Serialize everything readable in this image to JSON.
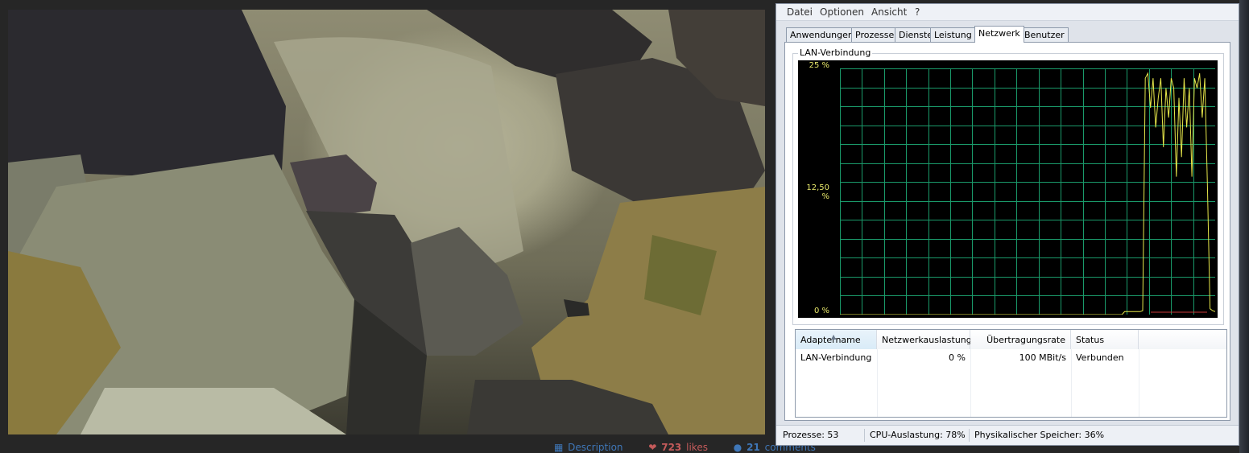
{
  "photo": {
    "alt_icons": [
      "grid-icon",
      "heart-icon",
      "comment-icon"
    ],
    "footer": {
      "description_label": "Description",
      "likes_count": "723",
      "likes_label": "likes",
      "comments_count": "21",
      "comments_label": "comments"
    }
  },
  "taskmanager": {
    "menu": [
      "Datei",
      "Optionen",
      "Ansicht",
      "?"
    ],
    "tabs": [
      "Anwendungen",
      "Prozesse",
      "Dienste",
      "Leistung",
      "Netzwerk",
      "Benutzer"
    ],
    "active_tab": "Netzwerk",
    "group_title": "LAN-Verbindung",
    "graph": {
      "y_labels": [
        "25 %",
        "12,50 %",
        "0 %"
      ],
      "y_max": 25,
      "grid_color": "#1a9a6a",
      "line_color": "#e7e74a",
      "recv_color": "#c83a3a",
      "samples": [
        0,
        0,
        0,
        0,
        0,
        0,
        0,
        0,
        0,
        0,
        0,
        0,
        0,
        0,
        0,
        0,
        0,
        0,
        0,
        0,
        0,
        0,
        0,
        0,
        0,
        0,
        0,
        0,
        0,
        0,
        0,
        0,
        0,
        0,
        0,
        0,
        0,
        0,
        0,
        0,
        0,
        0,
        0,
        0,
        0,
        0,
        0,
        0,
        0,
        0,
        0,
        0,
        0,
        0,
        0,
        0,
        0,
        0,
        0,
        0,
        0,
        0,
        0,
        0,
        0,
        0,
        0,
        0,
        0,
        0,
        0,
        0,
        0,
        0,
        0,
        0,
        0,
        0,
        0,
        0,
        0,
        0,
        0,
        0,
        0,
        0,
        0,
        0,
        0,
        0,
        0,
        0,
        0,
        0,
        0,
        0,
        0,
        0,
        0,
        0,
        0,
        0,
        0,
        0,
        0,
        0,
        0,
        0,
        0,
        0,
        0.3,
        0.3,
        0.3,
        0.3,
        0.3,
        0.3,
        0.3,
        0.4,
        24,
        24.5,
        21,
        24,
        19,
        22,
        24,
        17,
        23,
        20,
        24,
        23,
        14,
        22,
        16,
        24,
        19,
        23,
        14,
        24,
        23,
        24.5,
        20,
        24,
        13,
        0.6,
        0.4,
        0.3
      ]
    },
    "list": {
      "headers": [
        "Adaptername",
        "Netzwerkauslastung",
        "Übertragungsrate",
        "Status"
      ],
      "rows": [
        [
          "LAN-Verbindung",
          "0 %",
          "100 MBit/s",
          "Verbunden"
        ]
      ]
    },
    "status": {
      "processes": "Prozesse: 53",
      "cpu": "CPU-Auslastung: 78%",
      "memory": "Physikalischer Speicher: 36%"
    }
  }
}
